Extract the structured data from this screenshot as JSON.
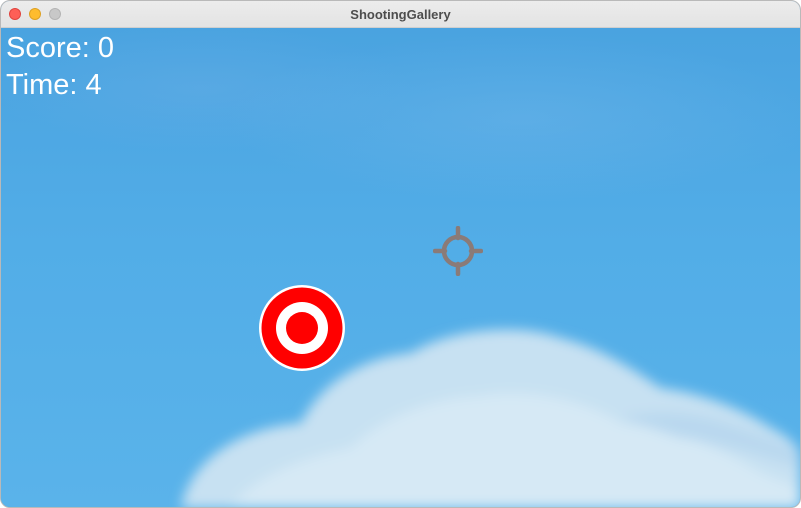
{
  "window": {
    "title": "ShootingGallery"
  },
  "hud": {
    "score_text": "Score: 0",
    "time_text": "Time: 4"
  },
  "game": {
    "score": 0,
    "time_remaining": 4
  },
  "icons": {
    "target": "target-bullseye-icon",
    "crosshair": "crosshair-icon"
  },
  "colors": {
    "sky": "#4fa8e4",
    "target_red": "#ff0000",
    "target_white": "#ffffff",
    "crosshair": "#8a7b78",
    "hud_text": "#ffffff"
  }
}
